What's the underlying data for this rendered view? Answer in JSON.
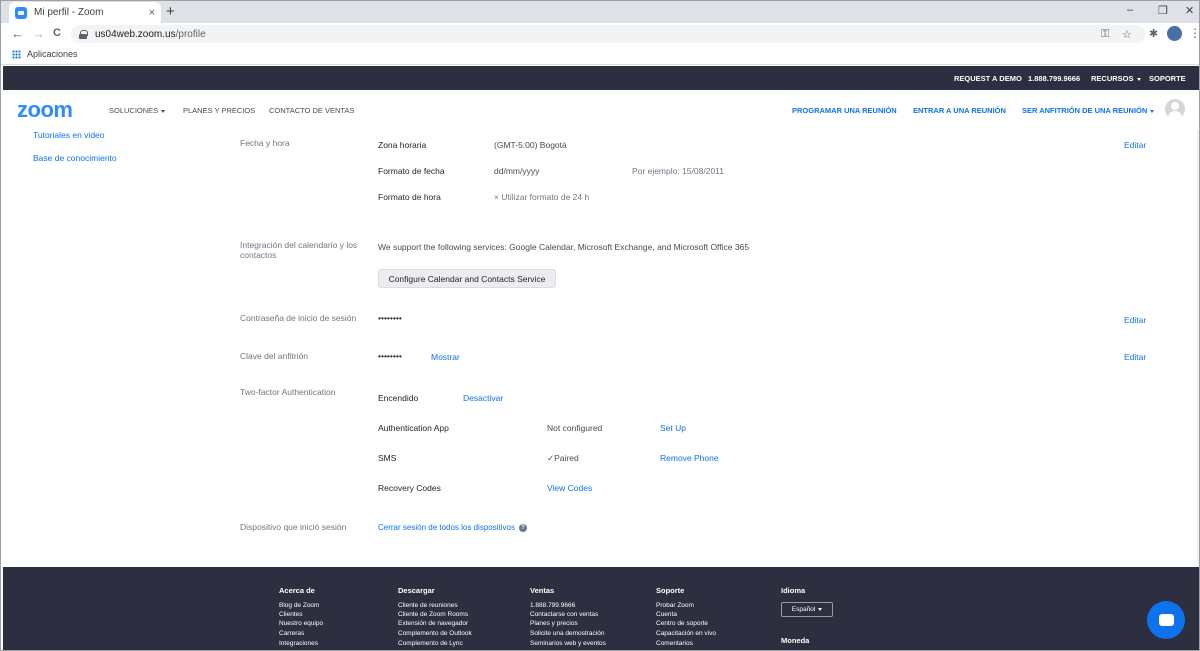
{
  "browser": {
    "tab_title": "Mi perfil - Zoom",
    "tab_close": "×",
    "new_tab": "+",
    "url_host": "us04web.zoom.us",
    "url_path": "/profile",
    "bookmark_apps": "Aplicaciones",
    "back": "←",
    "forward": "→",
    "reload": "C",
    "key_icon": "⚿",
    "star_icon": "☆",
    "ext_icon": "✱",
    "menu": "⋮",
    "minimize": "–",
    "restore": "❐",
    "close": "✕"
  },
  "topbar": {
    "request_demo": "REQUEST A DEMO",
    "phone": "1.888.799.9666",
    "resources": "RECURSOS",
    "support": "SOPORTE"
  },
  "nav": {
    "logo": "zoom",
    "solutions": "SOLUCIONES",
    "plans": "PLANES Y PRECIOS",
    "contact_sales": "CONTACTO DE VENTAS",
    "schedule": "PROGRAMAR UNA REUNIÓN",
    "join": "ENTRAR A UNA REUNIÓN",
    "host": "SER ANFITRIÓN DE UNA REUNIÓN"
  },
  "sidebar": {
    "tutorials": "Tutoriales en video",
    "knowledge_base": "Base de conocimiento"
  },
  "profile": {
    "date_time": {
      "section": "Fecha y hora",
      "tz_label": "Zona horaria",
      "tz_value": "(GMT-5:00) Bogotá",
      "date_format_label": "Formato de fecha",
      "date_format_value": "dd/mm/yyyy",
      "date_example": "Por ejemplo: 15/08/2011",
      "time_format_label": "Formato de hora",
      "time_format_value": "× Utilizar formato de 24 h",
      "edit": "Editar"
    },
    "calendar": {
      "section": "Integración del calendario y los contactos",
      "description": "We support the following services: Google Calendar, Microsoft Exchange, and Microsoft Office 365",
      "button": "Configure Calendar and Contacts Service"
    },
    "password": {
      "section": "Contraseña de inicio de sesión",
      "value": "••••••••",
      "edit": "Editar"
    },
    "host_key": {
      "section": "Clave del anfitrión",
      "value": "••••••••",
      "show": "Mostrar",
      "edit": "Editar"
    },
    "two_factor": {
      "section": "Two-factor Authentication",
      "status": "Encendido",
      "disable": "Desactivar",
      "auth_app_label": "Authentication App",
      "auth_app_status": "Not configured",
      "auth_app_action": "Set Up",
      "sms_label": "SMS",
      "sms_status": "✓Paired",
      "sms_action": "Remove Phone",
      "recovery_label": "Recovery Codes",
      "recovery_action": "View Codes"
    },
    "device": {
      "section": "Dispositivo que inició sesión",
      "action": "Cerrar sesión de todos los dispositivos",
      "help": "?"
    }
  },
  "footer": {
    "about": {
      "title": "Acerca de",
      "items": [
        "Blog de Zoom",
        "Clientes",
        "Nuestro equipo",
        "Carreras",
        "Integraciones"
      ]
    },
    "download": {
      "title": "Descargar",
      "items": [
        "Cliente de reuniones",
        "Cliente de Zoom Rooms",
        "Extensión de navegador",
        "Complemento de Outlook",
        "Complemento de Lync"
      ]
    },
    "sales": {
      "title": "Ventas",
      "items": [
        "1.888.799.9666",
        "Contactarse con ventas",
        "Planes y precios",
        "Solicite una demostración",
        "Seminarios web y eventos"
      ]
    },
    "support": {
      "title": "Soporte",
      "items": [
        "Probar Zoom",
        "Cuenta",
        "Centro de soporte",
        "Capacitación en vivo",
        "Comentarios"
      ]
    },
    "language": {
      "title": "Idioma",
      "value": "Español"
    },
    "currency": {
      "title": "Moneda"
    }
  }
}
